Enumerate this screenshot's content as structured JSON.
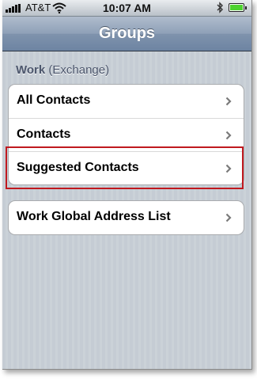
{
  "status_bar": {
    "carrier": "AT&T",
    "time": "10:07 AM",
    "signal_icon": "signal-bars-icon",
    "wifi_icon": "wifi-icon",
    "bluetooth_icon": "bluetooth-icon",
    "battery_icon": "battery-icon",
    "battery_level": 1.0
  },
  "nav_bar": {
    "title": "Groups"
  },
  "section": {
    "account": "Work",
    "type": "(Exchange)"
  },
  "groups": {
    "first": [
      {
        "label": "All Contacts"
      },
      {
        "label": "Contacts"
      },
      {
        "label": "Suggested Contacts"
      }
    ],
    "second": [
      {
        "label": "Work Global Address List"
      }
    ]
  },
  "colors": {
    "nav_bar": "#6d84a2",
    "background": "#c5ccd4",
    "highlight_box": "#c0191f",
    "battery_fill": "#4cd22e"
  }
}
